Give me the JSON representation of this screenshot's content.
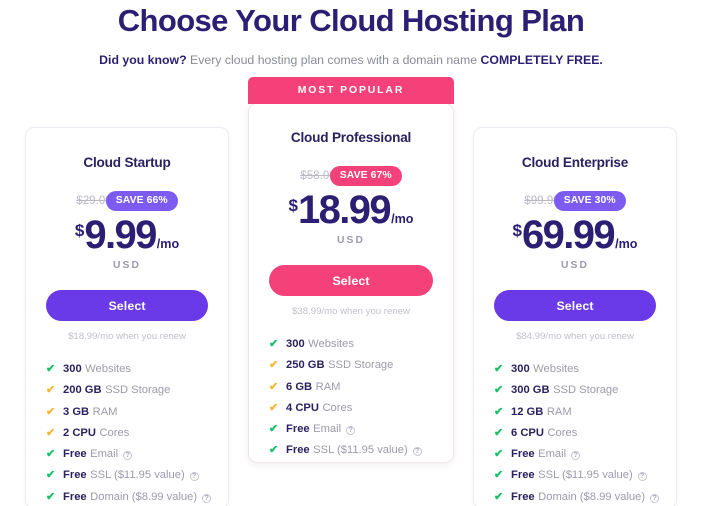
{
  "header": {
    "title": "Choose Your Cloud Hosting Plan",
    "subtitle_lead": "Did you know?",
    "subtitle_mid": " Every cloud hosting plan comes with a domain name ",
    "subtitle_caps": "COMPLETELY FREE."
  },
  "colors": {
    "heading": "#2b1e73",
    "purple_button": "#6a3ae8",
    "purple_badge": "#7c5cf0",
    "pink": "#f5417a",
    "check_green": "#17c06c",
    "check_yellow": "#f5b731",
    "muted_text": "#9b9baa"
  },
  "featured_banner_label": "MOST POPULAR",
  "plans": [
    {
      "name": "Cloud Startup",
      "old_price": "$29.00",
      "save_badge": "SAVE 66%",
      "currency_symbol": "$",
      "price": "9.99",
      "per_period": "/mo",
      "currency_code": "USD",
      "cta_label": "Select",
      "renew_note": "$18.99/mo when you renew",
      "features": [
        {
          "check": "green",
          "strong": "300",
          "rest": "Websites",
          "info": false
        },
        {
          "check": "yellow",
          "strong": "200 GB",
          "rest": "SSD Storage",
          "info": false
        },
        {
          "check": "yellow",
          "strong": "3 GB",
          "rest": "RAM",
          "info": false
        },
        {
          "check": "yellow",
          "strong": "2 CPU",
          "rest": "Cores",
          "info": false
        },
        {
          "check": "green",
          "strong": "Free",
          "rest": "Email",
          "info": true
        },
        {
          "check": "green",
          "strong": "Free",
          "rest": "SSL ($11.95 value)",
          "info": true
        },
        {
          "check": "green",
          "strong": "Free",
          "rest": "Domain ($8.99 value)",
          "info": true
        }
      ]
    },
    {
      "name": "Cloud Professional",
      "old_price": "$58.00",
      "save_badge": "SAVE 67%",
      "currency_symbol": "$",
      "price": "18.99",
      "per_period": "/mo",
      "currency_code": "USD",
      "cta_label": "Select",
      "renew_note": "$38.99/mo when you renew",
      "features": [
        {
          "check": "green",
          "strong": "300",
          "rest": "Websites",
          "info": false
        },
        {
          "check": "yellow",
          "strong": "250 GB",
          "rest": "SSD Storage",
          "info": false
        },
        {
          "check": "yellow",
          "strong": "6 GB",
          "rest": "RAM",
          "info": false
        },
        {
          "check": "yellow",
          "strong": "4 CPU",
          "rest": "Cores",
          "info": false
        },
        {
          "check": "green",
          "strong": "Free",
          "rest": "Email",
          "info": true
        },
        {
          "check": "green",
          "strong": "Free",
          "rest": "SSL ($11.95 value)",
          "info": true
        }
      ]
    },
    {
      "name": "Cloud Enterprise",
      "old_price": "$99.99",
      "save_badge": "SAVE 30%",
      "currency_symbol": "$",
      "price": "69.99",
      "per_period": "/mo",
      "currency_code": "USD",
      "cta_label": "Select",
      "renew_note": "$84.99/mo when you renew",
      "features": [
        {
          "check": "green",
          "strong": "300",
          "rest": "Websites",
          "info": false
        },
        {
          "check": "green",
          "strong": "300 GB",
          "rest": "SSD Storage",
          "info": false
        },
        {
          "check": "green",
          "strong": "12 GB",
          "rest": "RAM",
          "info": false
        },
        {
          "check": "green",
          "strong": "6 CPU",
          "rest": "Cores",
          "info": false
        },
        {
          "check": "green",
          "strong": "Free",
          "rest": "Email",
          "info": true
        },
        {
          "check": "green",
          "strong": "Free",
          "rest": "SSL ($11.95 value)",
          "info": true
        },
        {
          "check": "green",
          "strong": "Free",
          "rest": "Domain ($8.99 value)",
          "info": true
        }
      ]
    }
  ],
  "icons": {
    "check": "✔",
    "info": "?"
  }
}
